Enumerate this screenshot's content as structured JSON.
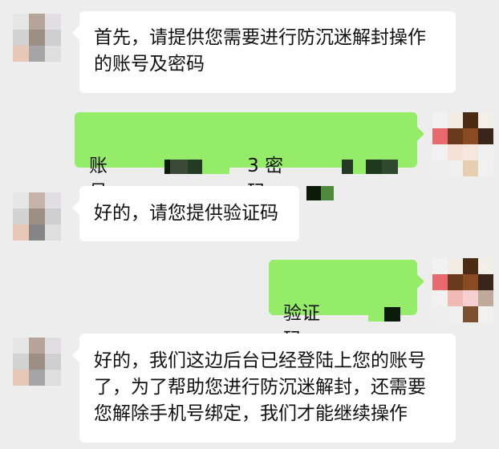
{
  "messages": [
    {
      "from": "other",
      "text": "首先，请提供您需要进行防沉迷解封操作\n的账号及密码"
    },
    {
      "from": "me",
      "prefix": "账号：",
      "middle": "3 密码：",
      "note": "redacted"
    },
    {
      "from": "other",
      "text": "好的，请您提供验证码"
    },
    {
      "from": "me",
      "prefix": "验证码",
      "middle": "",
      "note": "redacted"
    },
    {
      "from": "other",
      "text": "好的，我们这边后台已经登陆上您的账号\n了，为了帮助您进行防沉迷解封，还需要\n您解除手机号绑定，我们才能继续操作"
    }
  ],
  "colors": {
    "background": "#ededed",
    "incoming_bubble": "#ffffff",
    "outgoing_bubble": "#95ec69"
  }
}
